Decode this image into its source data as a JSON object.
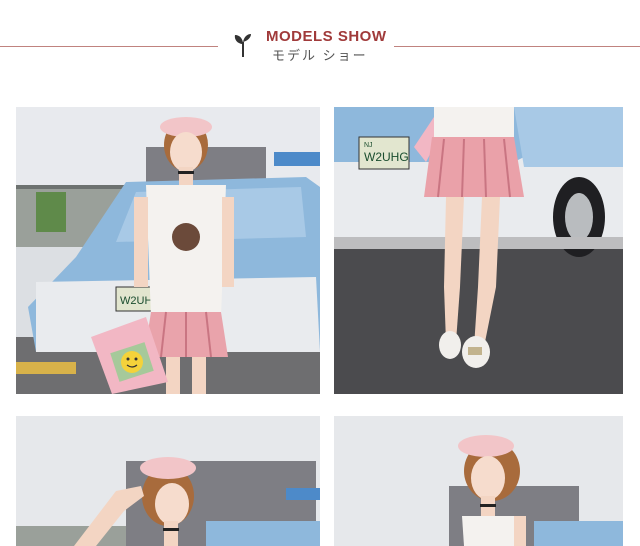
{
  "header": {
    "title": "MODELS SHOW",
    "subtitle": "モデル ショー",
    "accent_color": "#a03a3a",
    "icon": "sprout-icon"
  },
  "photos": {
    "p1": {
      "plate": "W2UHG"
    },
    "p2": {
      "plate": "W2UHG",
      "plate_top": "NJ"
    }
  }
}
